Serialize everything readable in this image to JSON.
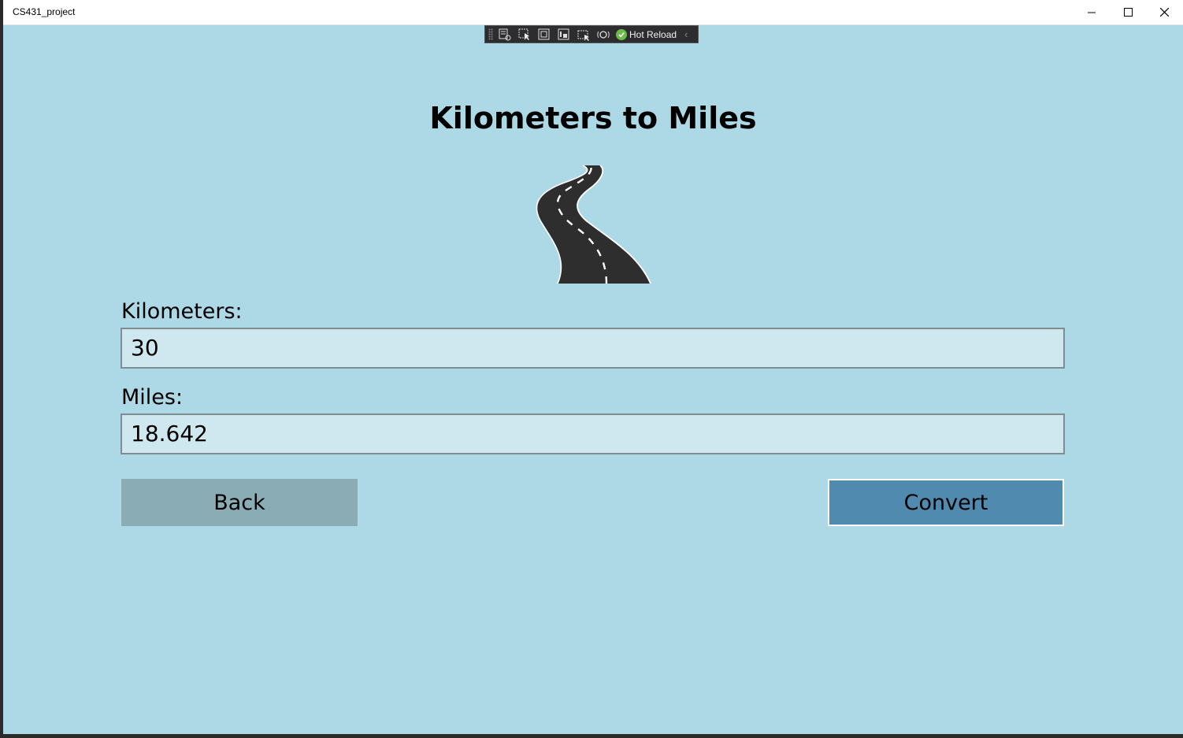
{
  "window": {
    "title": "CS431_project",
    "controls": [
      "minimize-icon",
      "maximize-icon",
      "close-icon"
    ]
  },
  "debug_toolbar": {
    "icons": [
      "live-visual-tree-icon",
      "select-element-icon",
      "display-layout-adorners-icon",
      "track-focus-icon",
      "binding-failures-icon",
      "xaml-hot-reload-settings-icon"
    ],
    "hot_reload_label": "Hot Reload",
    "status_icon": "checkmark-circle-icon",
    "status_color": "#6ebc48"
  },
  "page": {
    "title": "Kilometers to Miles",
    "image": "winding-road-icon",
    "kilometers_label": "Kilometers:",
    "kilometers_value": "30",
    "miles_label": "Miles:",
    "miles_value": "18.642",
    "back_label": "Back",
    "convert_label": "Convert"
  },
  "colors": {
    "background": "#add8e6",
    "field_background": "#cfe7ee",
    "back_button": "#8aacb5",
    "convert_button": "#518aaf"
  }
}
